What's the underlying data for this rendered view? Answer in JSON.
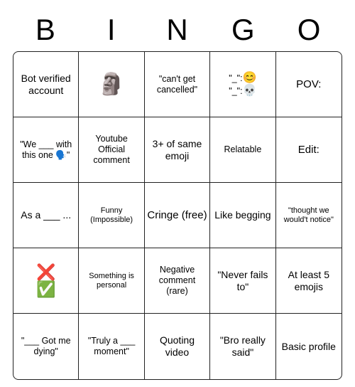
{
  "header": [
    "B",
    "I",
    "N",
    "G",
    "O"
  ],
  "cells": [
    {
      "text": "Bot verified account",
      "cls": ""
    },
    {
      "text": "🗿",
      "cls": "emoji-lg"
    },
    {
      "text": "\"can't get cancelled\"",
      "cls": "sm"
    },
    {
      "html": "<div class='two-line'><span>\"_\":<span class='e2'>😊</span></span><span>\"_\":<span class='e2'>💀</span></span></div>",
      "cls": "sm"
    },
    {
      "text": "POV:",
      "cls": "lg"
    },
    {
      "text": "\"We ___ with this one 🗣️\"",
      "cls": "sm"
    },
    {
      "text": "Youtube Official comment",
      "cls": "sm"
    },
    {
      "text": "3+ of same emoji",
      "cls": ""
    },
    {
      "text": "Relatable",
      "cls": "sm"
    },
    {
      "text": "Edit:",
      "cls": "lg"
    },
    {
      "text": "As a ___ ...",
      "cls": ""
    },
    {
      "text": "Funny (Impossible)",
      "cls": "xs"
    },
    {
      "text": "Cringe (free)",
      "cls": "lg"
    },
    {
      "text": "Like begging",
      "cls": ""
    },
    {
      "text": "\"thought we would't notice\"",
      "cls": "xs"
    },
    {
      "html": "<div class='two-line'><span class='e'>❌</span><span class='e'>✅</span></div>",
      "cls": ""
    },
    {
      "text": "Something is personal",
      "cls": "xs"
    },
    {
      "text": "Negative comment (rare)",
      "cls": "sm"
    },
    {
      "text": "\"Never fails to\"",
      "cls": ""
    },
    {
      "text": "At least 5 emojis",
      "cls": ""
    },
    {
      "text": "\"___ Got me dying\"",
      "cls": "sm"
    },
    {
      "text": "\"Truly a ___ moment\"",
      "cls": "sm"
    },
    {
      "text": "Quoting video",
      "cls": ""
    },
    {
      "text": "\"Bro really said\"",
      "cls": ""
    },
    {
      "text": "Basic profile",
      "cls": ""
    }
  ]
}
